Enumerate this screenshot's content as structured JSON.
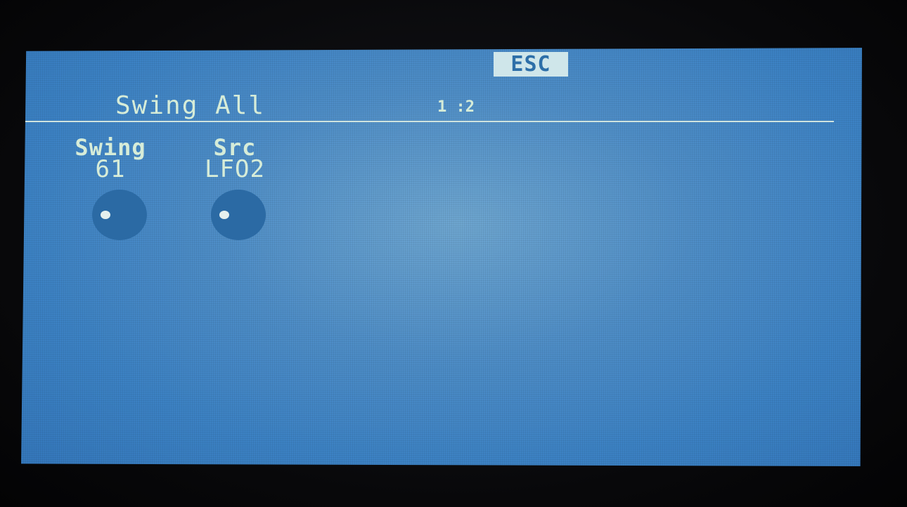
{
  "header": {
    "esc_label": "ESC",
    "title": "Swing All",
    "page_indicator": "1 :2"
  },
  "params": [
    {
      "label": "Swing",
      "value": "61"
    },
    {
      "label": "Src",
      "value": "LFO2"
    }
  ],
  "colors": {
    "screen": "#3c82c4",
    "text": "#d6ecd8",
    "esc_bg": "#cfe6ea",
    "knob": "#2b6aa4"
  }
}
